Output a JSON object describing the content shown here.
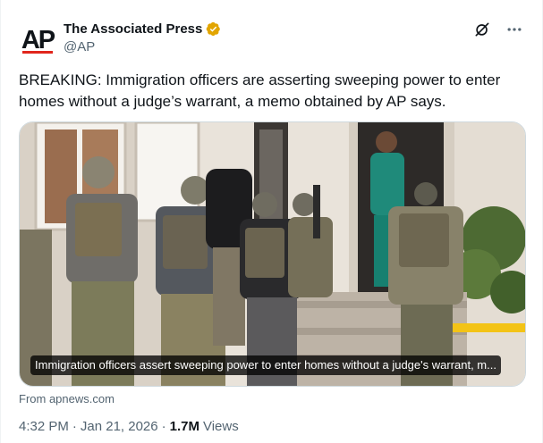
{
  "account": {
    "display_name": "The Associated Press",
    "handle": "@AP",
    "avatar_text": "AP",
    "verified": true,
    "verified_color": "#e2a500"
  },
  "post": {
    "text": "BREAKING: Immigration officers are asserting sweeping power to enter homes without a judge’s warrant, a memo obtained by AP says.",
    "media_caption": "Immigration officers assert sweeping power to enter homes without a judge's warrant, m...",
    "source": "From apnews.com"
  },
  "meta": {
    "time": "4:32 PM",
    "separator": "·",
    "date": "Jan 21, 2026",
    "views_count": "1.7M",
    "views_label": "Views"
  },
  "icons": {
    "grok": "grok-icon",
    "more": "more-icon",
    "verified": "verified-badge-icon"
  },
  "colors": {
    "text": "#0f1419",
    "secondary": "#536471",
    "brand_red": "#e1261c"
  }
}
